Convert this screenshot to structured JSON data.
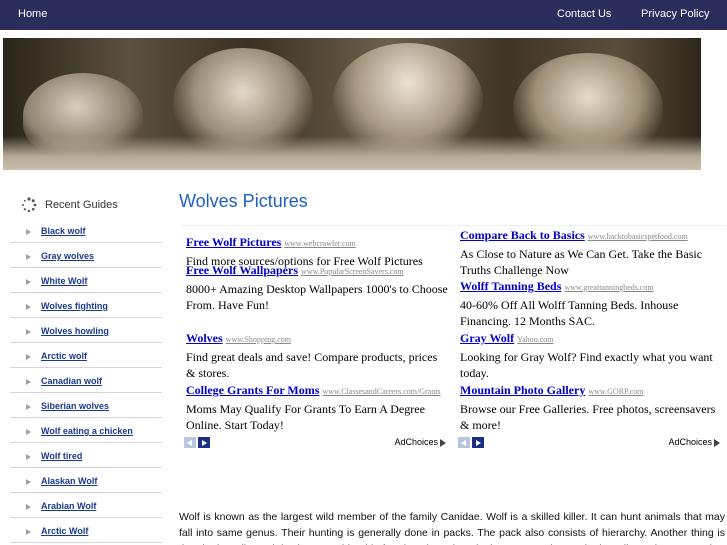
{
  "nav": {
    "home": "Home",
    "contact": "Contact Us",
    "privacy": "Privacy Policy"
  },
  "sidebar": {
    "title": "Recent Guides",
    "items": [
      "Black wolf",
      "Gray wolves",
      "White Wolf",
      "Wolves fighting",
      "Wolves howling",
      "Arctic wolf",
      "Canadian wolf",
      "Siberian wolves",
      "Wolf eating a chicken",
      "Wolf tired",
      "Alaskan Wolf",
      "Arabian Wolf",
      "Arctic Wolf"
    ]
  },
  "main": {
    "title": "Wolves Pictures",
    "body": "Wolf is known as the largest wild member of the family Canidae. Wolf is a skilled killer. It can hunt animals that may fall into same genus. Their hunting is generally done in packs. The pack also consists of hierarchy. Another thing is that the breeding pair is given considerable freedom that others in the same pack. Yet, the breeding pair can not take"
  },
  "ads": {
    "left": [
      {
        "title": "Free Wolf Pictures",
        "url": "www.webcrawler.com",
        "desc": "Find more sources/options for Free Wolf Pictures"
      },
      {
        "title": "Free Wolf Wallpapers",
        "url": "www.PopularScreenSavers.com",
        "desc": "8000+ Amazing Desktop Wallpapers 1000's to Choose From. Have Fun!"
      },
      {
        "title": "Wolves",
        "url": "www.Shopping.com",
        "desc": "Find great deals and save! Compare products, prices & stores."
      },
      {
        "title": "College Grants For Moms",
        "url": "www.ClassesandCareers.com/Grants",
        "desc": "Moms May Qualify For Grants To Earn A Degree Online. Start Today!"
      }
    ],
    "right": [
      {
        "title": "Compare Back to Basics",
        "url": "www.backtobasicspetfood.com",
        "desc": "As Close to Nature as We Can Get. Take the Basic Truths Challenge Now"
      },
      {
        "title": "Wolff Tanning Beds",
        "url": "www.greattanningbeds.com",
        "desc": "40-60% Off All Wolff Tanning Beds. Inhouse Financing. 12 Months SAC."
      },
      {
        "title": "Gray Wolf",
        "url": "Yahoo.com",
        "desc": "Looking for Gray Wolf? Find exactly what you want today."
      },
      {
        "title": "Mountain Photo Gallery",
        "url": "www.GORP.com",
        "desc": "Browse our Free Galleries. Free photos, screensavers & more!"
      }
    ],
    "adchoices": "AdChoices"
  },
  "icons": {
    "sidebar_header": "spinner-icon",
    "prev": "arrow-left-icon",
    "next": "arrow-right-icon",
    "adchoices": "adchoices-icon"
  },
  "colors": {
    "nav_bg": "#2b2d5c",
    "title_blue": "#1f5fbf",
    "link_blue": "#1a3a8f",
    "ad_link": "#0000cc"
  }
}
